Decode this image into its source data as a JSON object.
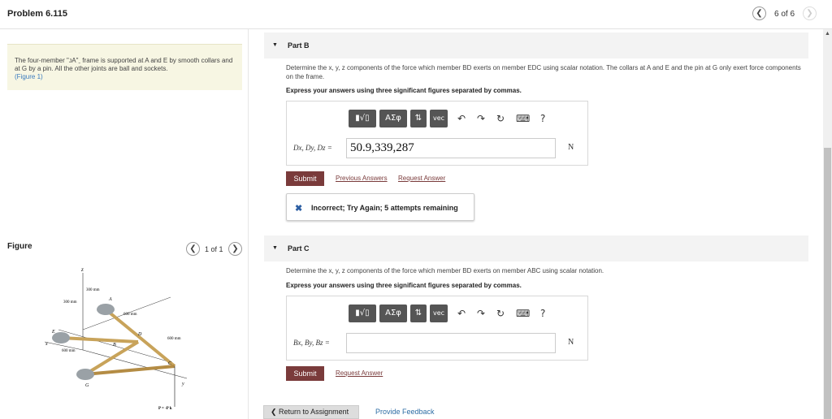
{
  "header": {
    "title": "Problem 6.115",
    "page_count": "6 of 6",
    "prev_icon": "chevron-left-icon",
    "next_icon": "chevron-right-icon"
  },
  "problem": {
    "text": "The four-member \"ᴊA\"ˍ frame is supported at A and E by smooth collars and at G by a pin. All the other joints are ball and sockets.",
    "figure_link": "(Figure 1)"
  },
  "figure": {
    "label": "Figure",
    "count": "1 of 1",
    "labels": {
      "z": "z",
      "d300a": "300 mm",
      "d300b": "300 mm",
      "d600a": "600 mm",
      "d600b": "600 mm",
      "d600c": "600 mm",
      "A": "A",
      "B": "B",
      "C": "C",
      "D": "D",
      "E": "E",
      "G": "G",
      "x": "x",
      "y": "y",
      "P": "P = -P k"
    }
  },
  "partB": {
    "title": "Part B",
    "question": "Determine the x, y, z components of the force which member BD exerts on member EDC using scalar notation. The collars at A and E and the pin at G only exert force components on the frame.",
    "instruction": "Express your answers using three significant figures separated by commas.",
    "toolbar": {
      "templates": "▮√▯",
      "greek": "ΑΣφ",
      "sort": "⇅",
      "vec": "vec",
      "undo": "↶",
      "redo": "↷",
      "reset": "↻",
      "keyboard": "⌨",
      "help": "?"
    },
    "answer_label": "Dx, Dy, Dz =",
    "answer_value": "50.9,339,287",
    "unit": "N",
    "submit": "Submit",
    "previous_answers": "Previous Answers",
    "request_answer": "Request Answer",
    "feedback": "Incorrect; Try Again; 5 attempts remaining"
  },
  "partC": {
    "title": "Part C",
    "question": "Determine the x, y, z components of the force which member BD exerts on member ABC using scalar notation.",
    "instruction": "Express your answers using three significant figures separated by commas.",
    "toolbar": {
      "templates": "▮√▯",
      "greek": "ΑΣφ",
      "sort": "⇅",
      "vec": "vec",
      "undo": "↶",
      "redo": "↷",
      "reset": "↻",
      "keyboard": "⌨",
      "help": "?"
    },
    "answer_label": "Bx, By, Bz =",
    "answer_value": "",
    "unit": "N",
    "submit": "Submit",
    "request_answer": "Request Answer"
  },
  "footer": {
    "return": "❮ Return to Assignment",
    "provide_feedback": "Provide Feedback"
  },
  "colors": {
    "submit": "#7a3b3b",
    "problem_bg": "#f7f6e3",
    "link": "#2e6da4",
    "toolbar": "#555555"
  }
}
